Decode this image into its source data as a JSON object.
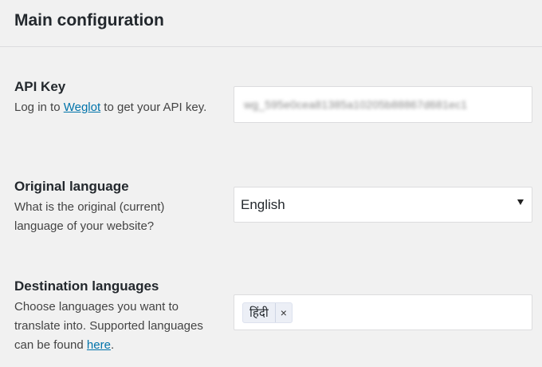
{
  "section": {
    "title": "Main configuration"
  },
  "api_key": {
    "label": "API Key",
    "desc_prefix": "Log in to ",
    "link_text": "Weglot",
    "desc_suffix": " to get your API key.",
    "value": "wg_595e0cea81385a10205b88867d681ec1"
  },
  "original_language": {
    "label": "Original language",
    "desc": "What is the original (current) language of your website?",
    "selected": "English"
  },
  "destination_languages": {
    "label": "Destination languages",
    "desc_prefix": "Choose languages you want to translate into. Supported languages can be found ",
    "link_text": "here",
    "desc_suffix": ".",
    "tags": [
      {
        "label": "हिंदी",
        "remove": "×"
      }
    ]
  }
}
